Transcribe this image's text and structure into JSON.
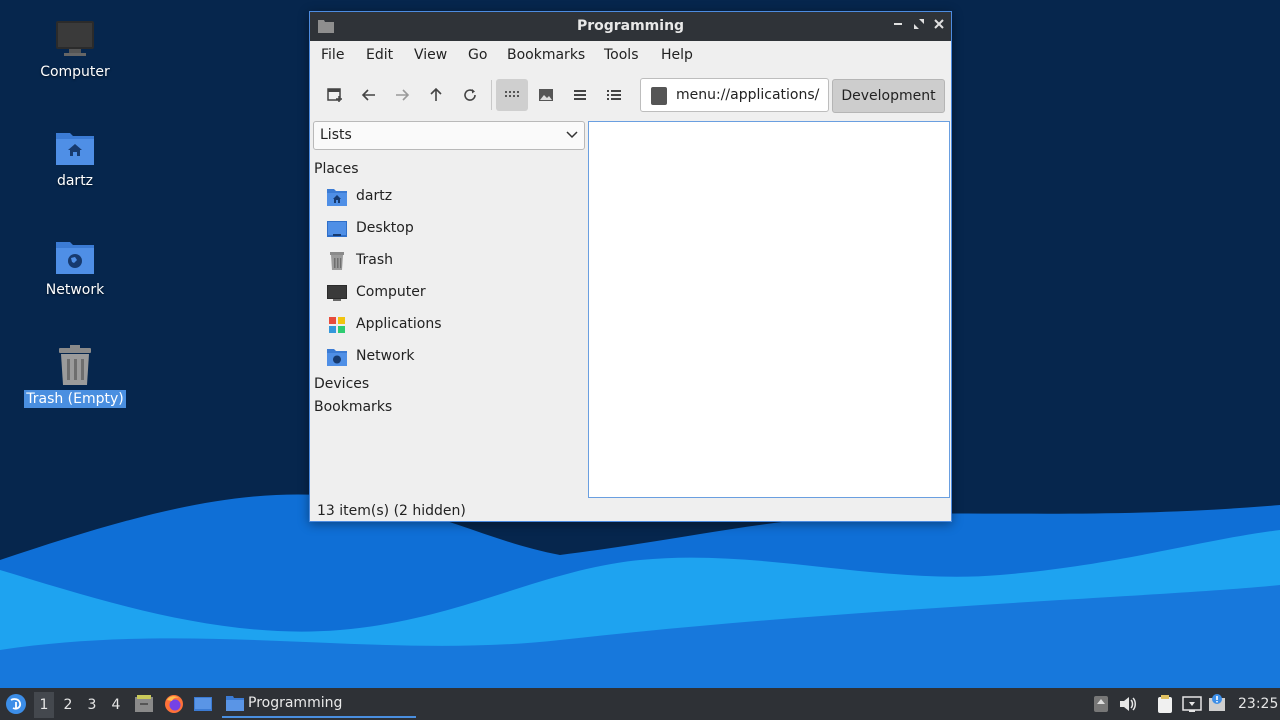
{
  "desktop": {
    "icons": [
      {
        "label": "Computer",
        "icon": "computer-icon"
      },
      {
        "label": "dartz",
        "icon": "home-folder-icon"
      },
      {
        "label": "Network",
        "icon": "network-folder-icon"
      },
      {
        "label": "Trash (Empty)",
        "icon": "trash-icon",
        "selected": true
      }
    ]
  },
  "window": {
    "title": "Programming",
    "menu": [
      "File",
      "Edit",
      "View",
      "Go",
      "Bookmarks",
      "Tools",
      "Help"
    ],
    "location": "menu://applications/",
    "path_button": "Development",
    "sidebar_mode": "Lists",
    "sections": {
      "places": "Places",
      "devices": "Devices",
      "bookmarks": "Bookmarks"
    },
    "places": [
      {
        "label": "dartz",
        "icon": "home-folder-icon"
      },
      {
        "label": "Desktop",
        "icon": "desktop-icon"
      },
      {
        "label": "Trash",
        "icon": "trash-icon"
      },
      {
        "label": "Computer",
        "icon": "computer-icon"
      },
      {
        "label": "Applications",
        "icon": "applications-icon"
      },
      {
        "label": "Network",
        "icon": "network-folder-icon"
      }
    ],
    "status": "13 item(s) (2 hidden)"
  },
  "taskbar": {
    "workspaces": [
      "1",
      "2",
      "3",
      "4"
    ],
    "active_workspace": "1",
    "task": "Programming",
    "clock": "23:25"
  },
  "colors": {
    "accent": "#4a8fe0",
    "titlebar": "#2f3338",
    "taskbar": "#2e3136",
    "desktop_bg": "#06264d"
  }
}
